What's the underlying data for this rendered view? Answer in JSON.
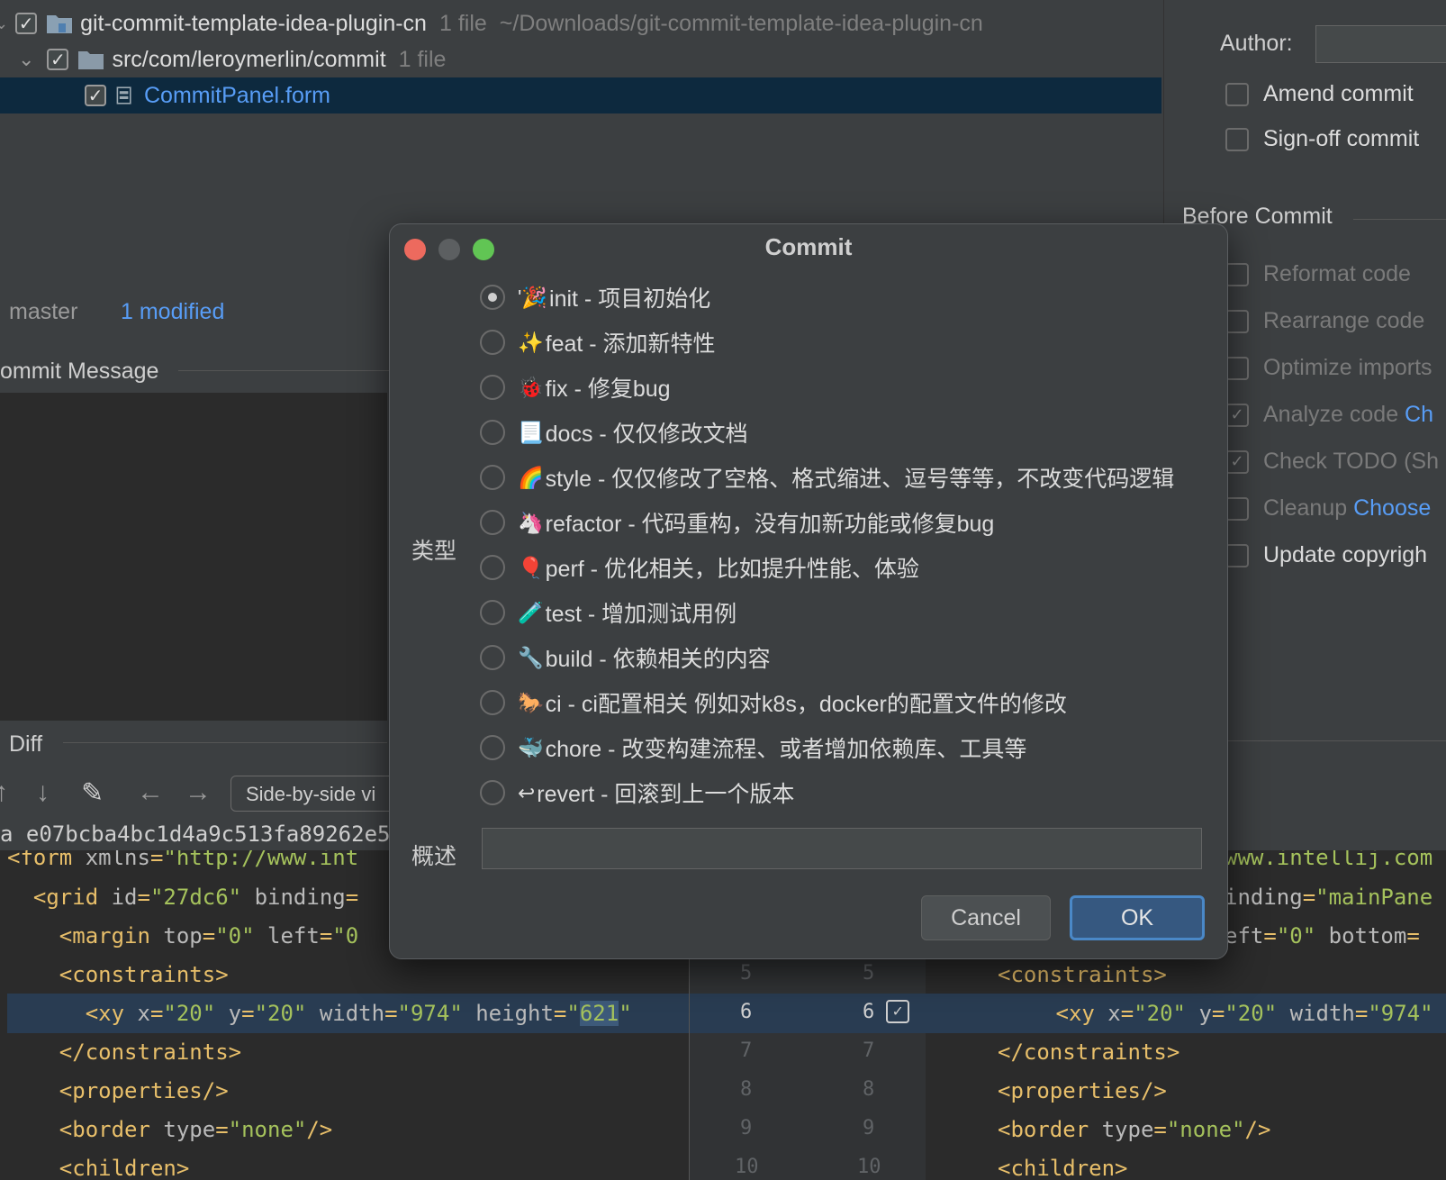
{
  "tree": {
    "rows": [
      {
        "name": "git-commit-template-idea-plugin-cn",
        "count": "1 file",
        "path": "~/Downloads/git-commit-template-idea-plugin-cn"
      },
      {
        "name": "src/com/leroymerlin/commit",
        "count": "1 file"
      },
      {
        "name": "CommitPanel.form"
      }
    ]
  },
  "status": {
    "branch": "master",
    "modified": "1 modified"
  },
  "commit_message": {
    "title": "ommit Message"
  },
  "diff": {
    "title": "Diff",
    "viewer": "Side-by-side vi",
    "hash": "a e07bcba4bc1d4a9c513fa89262e5"
  },
  "right_panel": {
    "author_label": "Author:",
    "amend": "Amend commit",
    "signoff": "Sign-off commit",
    "before_commit": "Before Commit",
    "options": [
      {
        "label": "Reformat code"
      },
      {
        "label": "Rearrange code"
      },
      {
        "label": "Optimize imports"
      },
      {
        "label": "Analyze code ",
        "link": "Ch"
      },
      {
        "label": "Check TODO (Sh"
      },
      {
        "label": "Cleanup ",
        "link": "Choose"
      },
      {
        "label": "Update copyrigh"
      }
    ]
  },
  "dialog": {
    "title": "Commit",
    "type_label": "类型",
    "summary_label": "概述",
    "cancel": "Cancel",
    "ok": "OK",
    "types": [
      {
        "emoji": "'🎉",
        "text": "init - 项目初始化",
        "selected": true
      },
      {
        "emoji": "✨",
        "text": "feat - 添加新特性"
      },
      {
        "emoji": "🐞",
        "text": "fix - 修复bug"
      },
      {
        "emoji": "📃",
        "text": "docs - 仅仅修改文档"
      },
      {
        "emoji": "🌈",
        "text": "style - 仅仅修改了空格、格式缩进、逗号等等，不改变代码逻辑"
      },
      {
        "emoji": "🦄",
        "text": "refactor - 代码重构，没有加新功能或修复bug"
      },
      {
        "emoji": "🎈",
        "text": "perf - 优化相关，比如提升性能、体验"
      },
      {
        "emoji": "🧪",
        "text": "test - 增加测试用例"
      },
      {
        "emoji": "🔧",
        "text": "build - 依赖相关的内容"
      },
      {
        "emoji": "🐎",
        "text": "ci - ci配置相关 例如对k8s，docker的配置文件的修改"
      },
      {
        "emoji": "🐳",
        "text": "chore - 改变构建流程、或者增加依赖库、工具等"
      },
      {
        "emoji": "↩",
        "text": "revert - 回滚到上一个版本"
      }
    ]
  },
  "code_left": [
    "<form xmlns=\"http://www.int",
    "  <grid id=\"27dc6\" binding=",
    "    <margin top=\"0\" left=\"0",
    "    <constraints>",
    "      <xy x=\"20\" y=\"20\" width=\"974\" height=\"621\"",
    "    </constraints>",
    "    <properties/>",
    "    <border type=\"none\"/>",
    "    <children>"
  ],
  "code_right": [
    "www.intellij.com",
    "inding=\"mainPane",
    "eft=\"0\" bottom=",
    "<constraints>",
    "  <xy x=\"20\" y=\"20\" width=\"974\"",
    "</constraints>",
    "<properties/>",
    "<border type=\"none\"/>",
    "<children>"
  ],
  "gutter": [
    {
      "l": "5",
      "r": "5"
    },
    {
      "l": "6",
      "r": "6"
    },
    {
      "l": "7",
      "r": "7"
    },
    {
      "l": "8",
      "r": "8"
    },
    {
      "l": "9",
      "r": "9"
    },
    {
      "l": "10",
      "r": "10"
    }
  ]
}
